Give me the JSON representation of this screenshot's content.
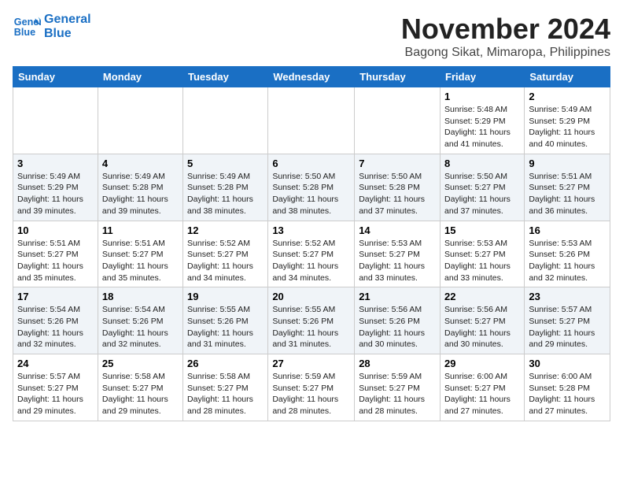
{
  "header": {
    "logo_line1": "General",
    "logo_line2": "Blue",
    "month": "November 2024",
    "location": "Bagong Sikat, Mimaropa, Philippines"
  },
  "weekdays": [
    "Sunday",
    "Monday",
    "Tuesday",
    "Wednesday",
    "Thursday",
    "Friday",
    "Saturday"
  ],
  "weeks": [
    [
      {
        "day": "",
        "info": ""
      },
      {
        "day": "",
        "info": ""
      },
      {
        "day": "",
        "info": ""
      },
      {
        "day": "",
        "info": ""
      },
      {
        "day": "",
        "info": ""
      },
      {
        "day": "1",
        "info": "Sunrise: 5:48 AM\nSunset: 5:29 PM\nDaylight: 11 hours\nand 41 minutes."
      },
      {
        "day": "2",
        "info": "Sunrise: 5:49 AM\nSunset: 5:29 PM\nDaylight: 11 hours\nand 40 minutes."
      }
    ],
    [
      {
        "day": "3",
        "info": "Sunrise: 5:49 AM\nSunset: 5:29 PM\nDaylight: 11 hours\nand 39 minutes."
      },
      {
        "day": "4",
        "info": "Sunrise: 5:49 AM\nSunset: 5:28 PM\nDaylight: 11 hours\nand 39 minutes."
      },
      {
        "day": "5",
        "info": "Sunrise: 5:49 AM\nSunset: 5:28 PM\nDaylight: 11 hours\nand 38 minutes."
      },
      {
        "day": "6",
        "info": "Sunrise: 5:50 AM\nSunset: 5:28 PM\nDaylight: 11 hours\nand 38 minutes."
      },
      {
        "day": "7",
        "info": "Sunrise: 5:50 AM\nSunset: 5:28 PM\nDaylight: 11 hours\nand 37 minutes."
      },
      {
        "day": "8",
        "info": "Sunrise: 5:50 AM\nSunset: 5:27 PM\nDaylight: 11 hours\nand 37 minutes."
      },
      {
        "day": "9",
        "info": "Sunrise: 5:51 AM\nSunset: 5:27 PM\nDaylight: 11 hours\nand 36 minutes."
      }
    ],
    [
      {
        "day": "10",
        "info": "Sunrise: 5:51 AM\nSunset: 5:27 PM\nDaylight: 11 hours\nand 35 minutes."
      },
      {
        "day": "11",
        "info": "Sunrise: 5:51 AM\nSunset: 5:27 PM\nDaylight: 11 hours\nand 35 minutes."
      },
      {
        "day": "12",
        "info": "Sunrise: 5:52 AM\nSunset: 5:27 PM\nDaylight: 11 hours\nand 34 minutes."
      },
      {
        "day": "13",
        "info": "Sunrise: 5:52 AM\nSunset: 5:27 PM\nDaylight: 11 hours\nand 34 minutes."
      },
      {
        "day": "14",
        "info": "Sunrise: 5:53 AM\nSunset: 5:27 PM\nDaylight: 11 hours\nand 33 minutes."
      },
      {
        "day": "15",
        "info": "Sunrise: 5:53 AM\nSunset: 5:27 PM\nDaylight: 11 hours\nand 33 minutes."
      },
      {
        "day": "16",
        "info": "Sunrise: 5:53 AM\nSunset: 5:26 PM\nDaylight: 11 hours\nand 32 minutes."
      }
    ],
    [
      {
        "day": "17",
        "info": "Sunrise: 5:54 AM\nSunset: 5:26 PM\nDaylight: 11 hours\nand 32 minutes."
      },
      {
        "day": "18",
        "info": "Sunrise: 5:54 AM\nSunset: 5:26 PM\nDaylight: 11 hours\nand 32 minutes."
      },
      {
        "day": "19",
        "info": "Sunrise: 5:55 AM\nSunset: 5:26 PM\nDaylight: 11 hours\nand 31 minutes."
      },
      {
        "day": "20",
        "info": "Sunrise: 5:55 AM\nSunset: 5:26 PM\nDaylight: 11 hours\nand 31 minutes."
      },
      {
        "day": "21",
        "info": "Sunrise: 5:56 AM\nSunset: 5:26 PM\nDaylight: 11 hours\nand 30 minutes."
      },
      {
        "day": "22",
        "info": "Sunrise: 5:56 AM\nSunset: 5:27 PM\nDaylight: 11 hours\nand 30 minutes."
      },
      {
        "day": "23",
        "info": "Sunrise: 5:57 AM\nSunset: 5:27 PM\nDaylight: 11 hours\nand 29 minutes."
      }
    ],
    [
      {
        "day": "24",
        "info": "Sunrise: 5:57 AM\nSunset: 5:27 PM\nDaylight: 11 hours\nand 29 minutes."
      },
      {
        "day": "25",
        "info": "Sunrise: 5:58 AM\nSunset: 5:27 PM\nDaylight: 11 hours\nand 29 minutes."
      },
      {
        "day": "26",
        "info": "Sunrise: 5:58 AM\nSunset: 5:27 PM\nDaylight: 11 hours\nand 28 minutes."
      },
      {
        "day": "27",
        "info": "Sunrise: 5:59 AM\nSunset: 5:27 PM\nDaylight: 11 hours\nand 28 minutes."
      },
      {
        "day": "28",
        "info": "Sunrise: 5:59 AM\nSunset: 5:27 PM\nDaylight: 11 hours\nand 28 minutes."
      },
      {
        "day": "29",
        "info": "Sunrise: 6:00 AM\nSunset: 5:27 PM\nDaylight: 11 hours\nand 27 minutes."
      },
      {
        "day": "30",
        "info": "Sunrise: 6:00 AM\nSunset: 5:28 PM\nDaylight: 11 hours\nand 27 minutes."
      }
    ]
  ]
}
